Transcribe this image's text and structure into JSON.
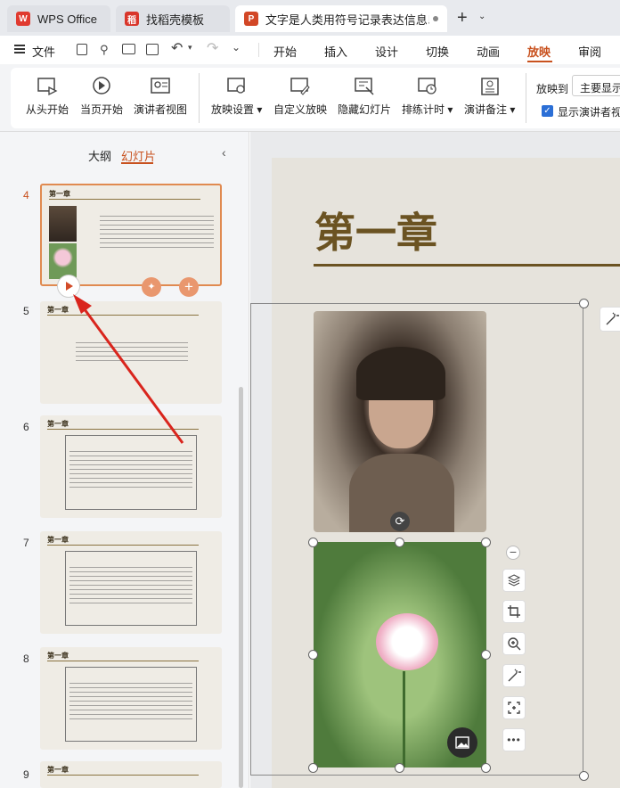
{
  "titlebar": {
    "tabs": [
      {
        "label": "WPS Office",
        "icon": "wps-logo-icon"
      },
      {
        "label": "找稻壳模板",
        "icon": "docer-icon"
      },
      {
        "label": "文字是人类用符号记录表达信息以",
        "icon": "ppt-icon"
      }
    ]
  },
  "menubar": {
    "file": "文件",
    "tabs": [
      "开始",
      "插入",
      "设计",
      "切换",
      "动画",
      "放映",
      "审阅"
    ],
    "active_tab": "放映"
  },
  "ribbon": {
    "buttons": [
      "从头开始",
      "当页开始",
      "演讲者视图",
      "放映设置",
      "自定义放映",
      "隐藏幻灯片",
      "排练计时",
      "演讲备注"
    ],
    "play_to_label": "放映到",
    "play_to_value": "主要显示",
    "show_presenter_label": "显示演讲者视"
  },
  "panel": {
    "outline_tab": "大纲",
    "slides_tab": "幻灯片",
    "slide_numbers": [
      "4",
      "5",
      "6",
      "7",
      "8",
      "9"
    ],
    "thumb_title": "第一章"
  },
  "slide": {
    "title": "第一章"
  },
  "colors": {
    "accent": "#c8511e",
    "slide_bg": "#e6e3dc",
    "title_color": "#6b5322",
    "rule_color": "#6b5322"
  }
}
